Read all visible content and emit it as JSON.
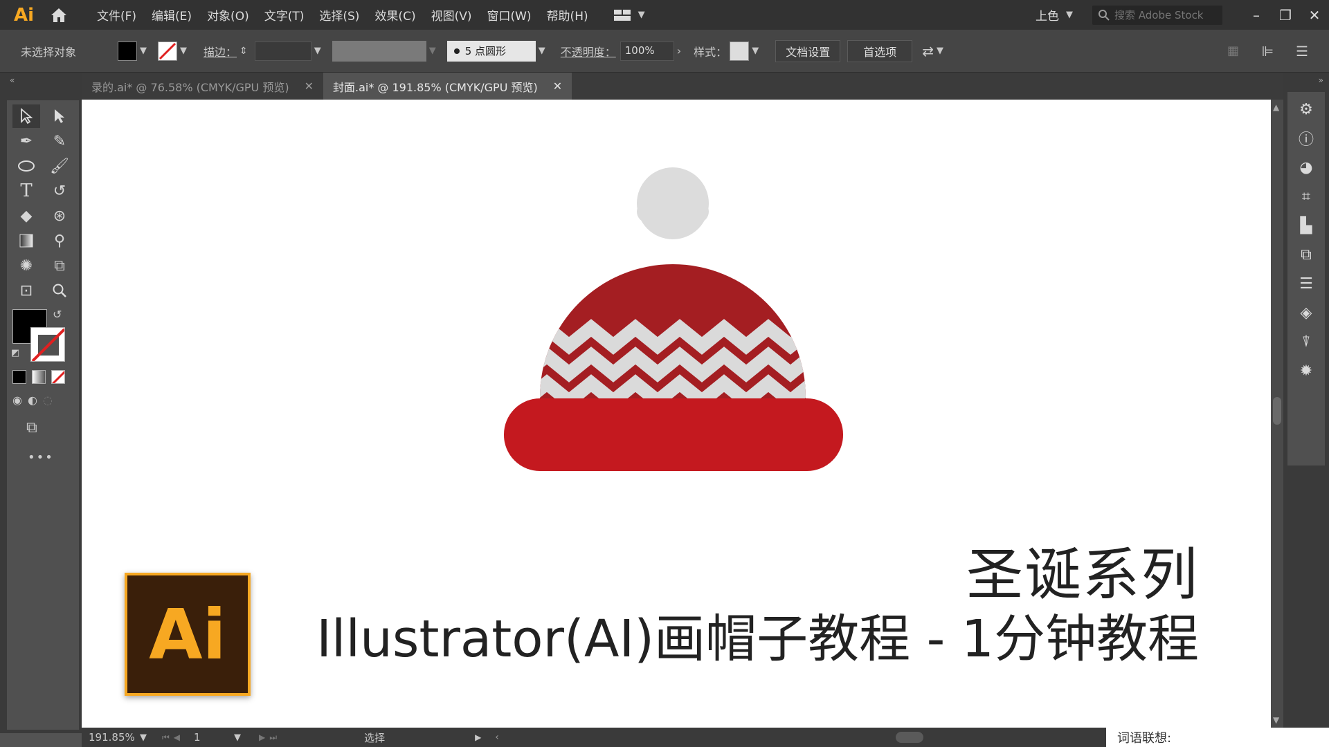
{
  "app": {
    "logo": "Ai",
    "menus": [
      "文件(F)",
      "编辑(E)",
      "对象(O)",
      "文字(T)",
      "选择(S)",
      "效果(C)",
      "视图(V)",
      "窗口(W)",
      "帮助(H)"
    ],
    "workspace": "上色",
    "stock_search_placeholder": "搜索 Adobe Stock"
  },
  "control_bar": {
    "selection_status": "未选择对象",
    "stroke_label": "描边：",
    "brush_label": "5 点圆形",
    "opacity_label": "不透明度：",
    "opacity_value": "100%",
    "style_label": "样式：",
    "doc_settings": "文档设置",
    "preferences": "首选项"
  },
  "tabs": [
    {
      "label": "录的.ai* @ 76.58% (CMYK/GPU 预览)",
      "active": false
    },
    {
      "label": "封面.ai* @ 191.85% (CMYK/GPU 预览)",
      "active": true
    }
  ],
  "artwork": {
    "series_title": "圣诞系列",
    "tutorial_title": "Illustrator(AI)画帽子教程 - 1分钟教程",
    "badge_text": "Ai",
    "colors": {
      "hat_top": "#a41e22",
      "hat_band": "#c4191f",
      "zigzag": "#dadada",
      "pompom": "#dcdcdc"
    }
  },
  "status_bar": {
    "zoom": "191.85%",
    "artboard": "1",
    "tool_status": "选择"
  },
  "ime": {
    "label": "词语联想:"
  },
  "icons": {
    "home": "home-icon",
    "search": "search-icon",
    "minimize": "minimize-icon",
    "restore": "restore-icon",
    "close": "close-icon"
  }
}
